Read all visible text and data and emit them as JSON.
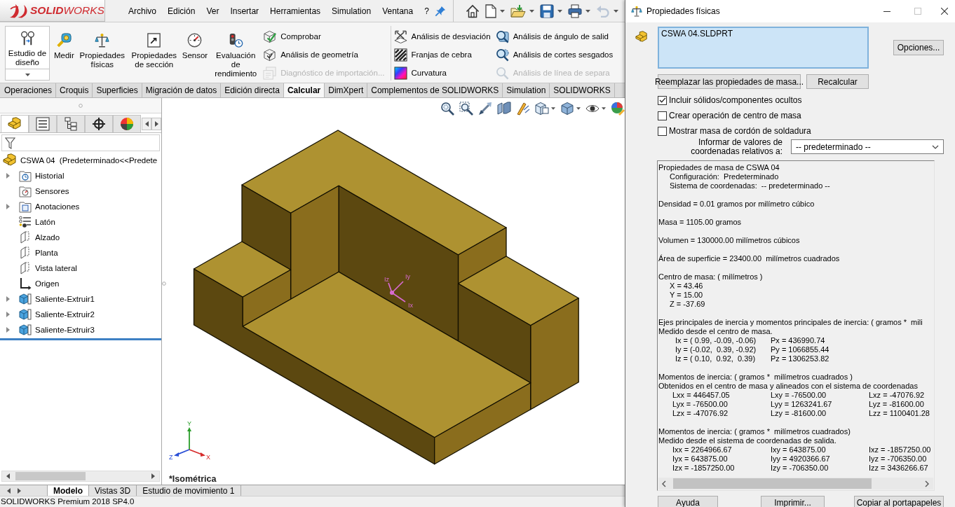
{
  "menubar": {
    "logo": "**SOLID**WORKS",
    "menu": [
      "Archivo",
      "Edición",
      "Ver",
      "Insertar",
      "Herramientas",
      "Simulation",
      "Ventana",
      "?"
    ],
    "quick_access": [
      {
        "kind": "home",
        "dropdown": false,
        "disabled": false
      },
      {
        "kind": "new",
        "dropdown": true,
        "disabled": false
      },
      {
        "kind": "open",
        "dropdown": true,
        "disabled": false
      },
      {
        "kind": "save",
        "dropdown": true,
        "disabled": false
      },
      {
        "kind": "print",
        "dropdown": true,
        "disabled": false
      },
      {
        "kind": "undo",
        "dropdown": true,
        "disabled": true
      }
    ]
  },
  "command_manager": {
    "large_buttons": [
      {
        "kind": "design-study",
        "label": "Estudio de diseño",
        "dropdown": true
      },
      {
        "kind": "measure",
        "label": "Medir",
        "dropdown": false
      },
      {
        "kind": "mass",
        "label": "Propiedades físicas",
        "dropdown": false
      },
      {
        "kind": "section",
        "label": "Propiedades de sección",
        "dropdown": false
      },
      {
        "kind": "sensor",
        "label": "Sensor",
        "dropdown": false
      },
      {
        "kind": "performance",
        "label": "Evaluación de rendimiento",
        "dropdown": false
      }
    ],
    "groups": [
      {
        "columns": [
          [
            {
              "kind": "check",
              "label": "Comprobar",
              "disabled": false
            },
            {
              "kind": "geometry",
              "label": "Análisis de geometría",
              "disabled": false
            },
            {
              "kind": "import",
              "label": "Diagnóstico de importación...",
              "disabled": true
            }
          ]
        ]
      },
      {
        "columns": [
          [
            {
              "kind": "deviation",
              "label": "Análisis de desviación",
              "disabled": false
            },
            {
              "kind": "zebra",
              "label": "Franjas de cebra",
              "disabled": false
            },
            {
              "kind": "curvature",
              "label": "Curvatura",
              "disabled": false
            }
          ],
          [
            {
              "kind": "draft",
              "label": "Análisis de ángulo de salid",
              "disabled": false
            },
            {
              "kind": "undercut",
              "label": "Análisis de cortes sesgados",
              "disabled": false
            },
            {
              "kind": "parting",
              "label": "Análisis de línea de separa",
              "disabled": true
            }
          ]
        ]
      }
    ]
  },
  "tabs": [
    {
      "label": "Operaciones",
      "selected": false
    },
    {
      "label": "Croquis",
      "selected": false
    },
    {
      "label": "Superficies",
      "selected": false
    },
    {
      "label": "Migración de datos",
      "selected": false
    },
    {
      "label": "Edición directa",
      "selected": false
    },
    {
      "label": "Calcular",
      "selected": true
    },
    {
      "label": "DimXpert",
      "selected": false
    },
    {
      "label": "Complementos de SOLIDWORKS",
      "selected": false
    },
    {
      "label": "Simulation",
      "selected": false
    },
    {
      "label": "SOLIDWORKS",
      "selected": false
    }
  ],
  "feature_manager": {
    "tabs": [
      {
        "kind": "tree",
        "selected": true
      },
      {
        "kind": "properties",
        "selected": false
      },
      {
        "kind": "configurations",
        "selected": false
      },
      {
        "kind": "dimxpert",
        "selected": false
      },
      {
        "kind": "display",
        "selected": false
      }
    ],
    "tree": {
      "kind": "part",
      "label": "CSWA 04  (Predeterminado<<Predete",
      "children": [
        {
          "kind": "history",
          "label": "Historial",
          "expandable": true
        },
        {
          "kind": "sensors",
          "label": "Sensores",
          "expandable": false
        },
        {
          "kind": "annotations",
          "label": "Anotaciones",
          "expandable": true
        },
        {
          "kind": "material",
          "label": "Latón",
          "expandable": false
        },
        {
          "kind": "plane",
          "label": "Alzado",
          "expandable": false
        },
        {
          "kind": "plane",
          "label": "Planta",
          "expandable": false
        },
        {
          "kind": "plane",
          "label": "Vista lateral",
          "expandable": false
        },
        {
          "kind": "origin",
          "label": "Origen",
          "expandable": false
        },
        {
          "kind": "extrude",
          "label": "Saliente-Extruir1",
          "expandable": true
        },
        {
          "kind": "extrude",
          "label": "Saliente-Extruir2",
          "expandable": true
        },
        {
          "kind": "extrude",
          "label": "Saliente-Extruir3",
          "expandable": true
        }
      ]
    }
  },
  "graphics": {
    "view_toolbar": [
      {
        "kind": "zoom-fit",
        "dropdown": false
      },
      {
        "kind": "zoom-area",
        "dropdown": false
      },
      {
        "kind": "previous-view",
        "dropdown": false
      },
      {
        "kind": "section-view",
        "dropdown": false
      },
      {
        "kind": "annotation-views",
        "dropdown": false
      },
      {
        "kind": "view-orientation",
        "dropdown": true
      },
      {
        "kind": "display-style",
        "dropdown": true
      },
      {
        "kind": "hide-show",
        "dropdown": true
      },
      {
        "kind": "appearance",
        "dropdown": false
      }
    ],
    "axis_labels": [
      "Iz",
      "Iy",
      "Ix"
    ],
    "triad_labels": [
      "Y",
      "X",
      "Z"
    ],
    "view_name": "*Isométrica"
  },
  "bottom_tabs": [
    {
      "label": "Modelo",
      "selected": true
    },
    {
      "label": "Vistas 3D",
      "selected": false
    },
    {
      "label": "Estudio de movimiento 1",
      "selected": false
    }
  ],
  "status_bar": "SOLIDWORKS Premium 2018 SP4.0",
  "dialog": {
    "title": "Propiedades físicas",
    "selection": [
      "CSWA 04.SLDPRT"
    ],
    "options_button": "Opciones...",
    "actions": [
      "Reemplazar las propiedades de masa...",
      "Recalcular"
    ],
    "checkboxes": [
      {
        "label": "Incluir sólidos/componentes ocultos",
        "checked": true
      },
      {
        "label": "Crear operación de centro de masa",
        "checked": false
      },
      {
        "label": "Mostrar masa de cordón de soldadura",
        "checked": false
      }
    ],
    "coordinates": {
      "label": "Informar de valores de coordenadas relativos a:",
      "value": "-- predeterminado --"
    },
    "results": [
      {
        "text": [
          "Propiedades de masa de CSWA 04"
        ],
        "items": [
          "Configuración:  Predeterminado",
          "Sistema de coordenadas:  -- predeterminado --"
        ]
      },
      {
        "text": [
          "Densidad = 0.01 gramos por milímetro cúbico"
        ]
      },
      {
        "text": [
          "Masa = 1105.00 gramos"
        ]
      },
      {
        "text": [
          "Volumen = 130000.00 milímetros cúbicos"
        ]
      },
      {
        "text": [
          "Área de superficie = 23400.00  milímetros cuadrados"
        ]
      },
      {
        "text": [
          "Centro de masa: ( milímetros )"
        ],
        "items": [
          "X = 43.46",
          "Y = 15.00",
          "Z = -37.69"
        ]
      },
      {
        "text": [
          "Ejes principales de inercia y momentos principales de inercia: ( gramos *  mili",
          "Medido desde el centro de masa."
        ],
        "rows": [
          [
            "Ix = ( 0.99, -0.09, -0.06)",
            "Px = 436990.74"
          ],
          [
            "Iy = (-0.02,  0.39, -0.92)",
            "Py = 1066855.44"
          ],
          [
            "Iz = ( 0.10,  0.92,  0.39)",
            "Pz = 1306253.82"
          ]
        ]
      },
      {
        "text": [
          "Momentos de inercia: ( gramos *  milímetros cuadrados )",
          "Obtenidos en el centro de masa y alineados con el sistema de coordenadas"
        ],
        "rows": [
          [
            "Lxx = 446457.05",
            "Lxy = -76500.00",
            "Lxz = -47076.92"
          ],
          [
            "Lyx = -76500.00",
            "Lyy = 1263241.67",
            "Lyz = -81600.00"
          ],
          [
            "Lzx = -47076.92",
            "Lzy = -81600.00",
            "Lzz = 1100401.28"
          ]
        ]
      },
      {
        "text": [
          "Momentos de inercia: ( gramos *  milímetros cuadrados)",
          "Medido desde el sistema de coordenadas de salida."
        ],
        "rows": [
          [
            "Ixx = 2264966.67",
            "Ixy = 643875.00",
            "Ixz = -1857250.00"
          ],
          [
            "Iyx = 643875.00",
            "Iyy = 4920366.67",
            "Iyz = -706350.00"
          ],
          [
            "Izx = -1857250.00",
            "Izy = -706350.00",
            "Izz = 3436266.67"
          ]
        ]
      }
    ],
    "footer_buttons": [
      "Ayuda",
      "Imprimir...",
      "Copiar al portapapeles"
    ]
  }
}
